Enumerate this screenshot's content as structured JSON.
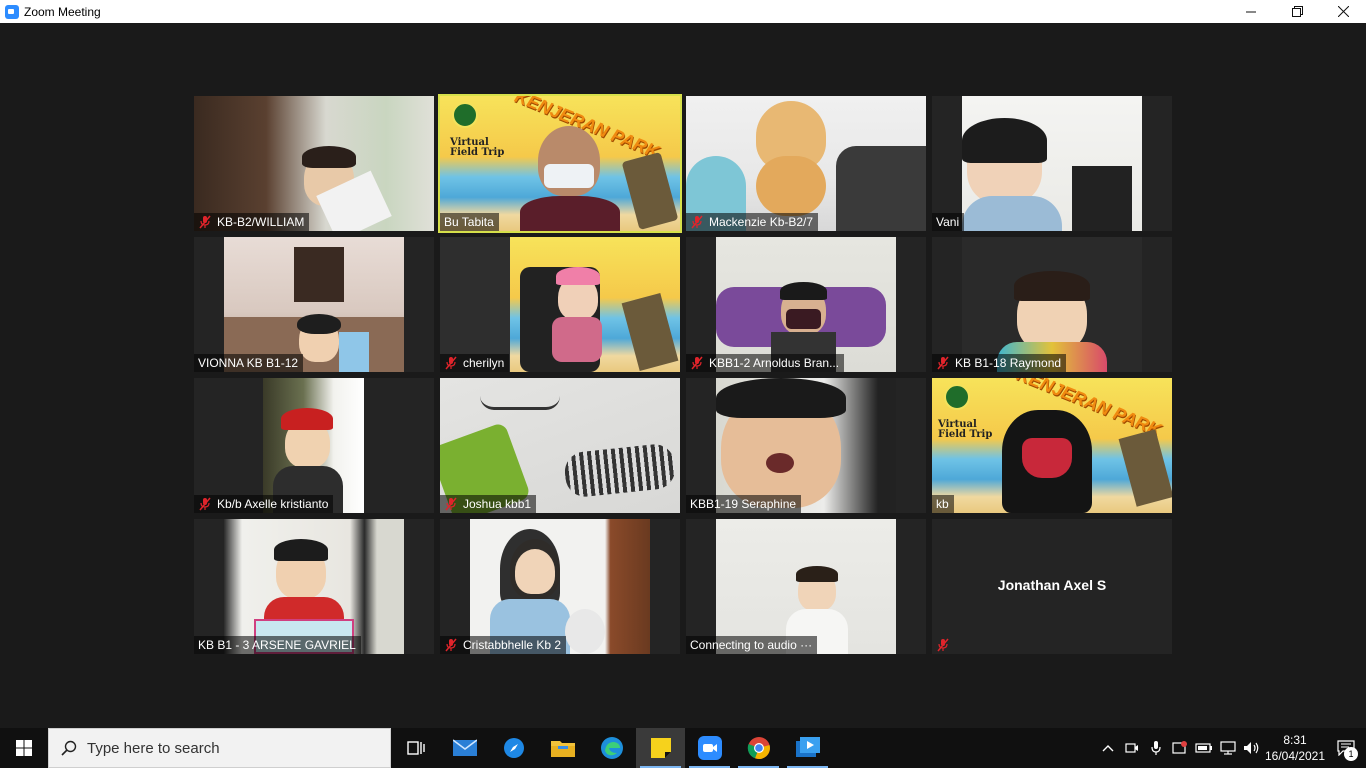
{
  "window": {
    "title": "Zoom Meeting"
  },
  "participants": [
    {
      "name": "KB-B2/WILLIAM",
      "muted": true
    },
    {
      "name": "Bu Tabita",
      "muted": false,
      "active_speaker": true
    },
    {
      "name": "Mackenzie Kb-B2/7",
      "muted": true
    },
    {
      "name": "Vani",
      "muted": false
    },
    {
      "name": "VIONNA KB B1-12",
      "muted": false
    },
    {
      "name": "cherilyn",
      "muted": true
    },
    {
      "name": "KBB1-2 Arnoldus Bran...",
      "muted": true
    },
    {
      "name": "KB B1-18 Raymond",
      "muted": true
    },
    {
      "name": "Kb/b Axelle kristianto",
      "muted": true
    },
    {
      "name": "Joshua kbb1",
      "muted": true
    },
    {
      "name": "KBB1-19 Seraphine",
      "muted": false
    },
    {
      "name": "kb",
      "muted": false
    },
    {
      "name": "KB B1 - 3 ARSENE GAVRIEL",
      "muted": false
    },
    {
      "name": "Cristabbhelle Kb 2",
      "muted": true
    },
    {
      "name": "Connecting to audio ···",
      "muted": false
    },
    {
      "name": "Jonathan Axel S",
      "muted": true,
      "video_off": true
    }
  ],
  "banner": {
    "park_title": "KENJERAN PARK",
    "trip_line1": "Virtual",
    "trip_line2": "Field Trip"
  },
  "taskbar": {
    "search_placeholder": "Type here to search",
    "time": "8:31",
    "date": "16/04/2021",
    "notification_count": "1"
  },
  "colors": {
    "active_speaker_border": "#d6e04a",
    "mute_red": "#e0242b",
    "meeting_bg": "#1a1a1a",
    "tile_bg": "#242424"
  }
}
